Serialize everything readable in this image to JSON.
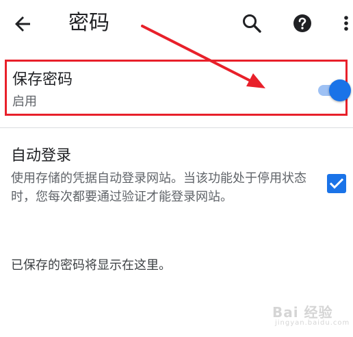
{
  "app_bar": {
    "title": "密码",
    "icons": [
      "back-arrow-icon",
      "search-icon",
      "help-icon",
      "more-vert-icon"
    ]
  },
  "save_passwords": {
    "title": "保存密码",
    "status": "启用",
    "enabled": true
  },
  "auto_sign_in": {
    "title": "自动登录",
    "description": "使用存储的凭据自动登录网站。当该功能处于停用状态时，您每次都要通过验证才能登录网站。",
    "checked": true
  },
  "empty_note": "已保存的密码将显示在这里。",
  "watermark": {
    "main": "Bai 经验",
    "sub": "jingyan.baidu.com"
  },
  "colors": {
    "accent": "#1a73e8",
    "toggle_track": "#9ec1f4",
    "highlight_border": "#e8202a",
    "annotation_arrow": "#e8202a"
  }
}
